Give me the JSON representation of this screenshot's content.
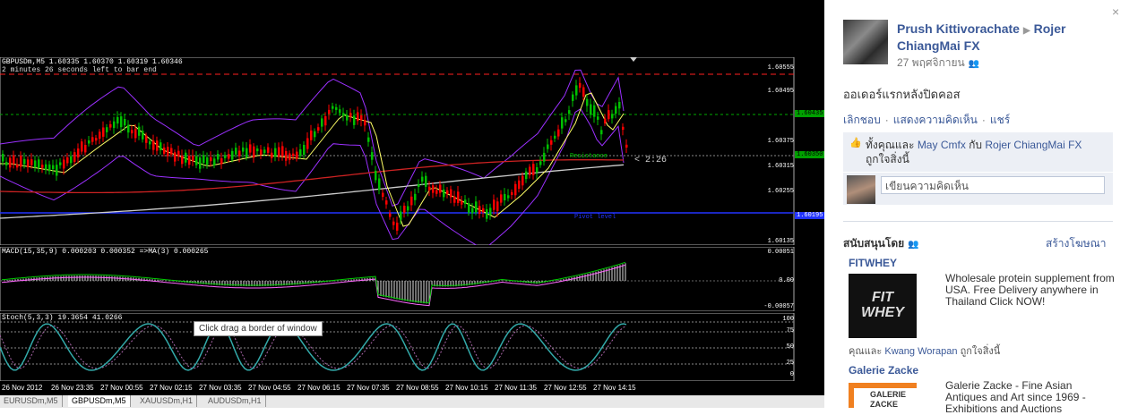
{
  "chart": {
    "price_title": "GBPUSDm,M5  1.60335 1.60370 1.60319 1.60346",
    "price_subtitle": "2 minutes 26 seconds left to bar end",
    "price_levels": [
      "1.60555",
      "1.60495",
      "1.60375",
      "1.60315",
      "1.60255",
      "1.60135"
    ],
    "price_badges": [
      "1.60435",
      "1.60350",
      "1.60195"
    ],
    "countdown": "< 2:26",
    "label_resistance": "Resistance",
    "label_pivot": "Pivot level",
    "macd_title": "MACD(15,35,9) 0.000203 0.000352  =>MA(3) 0.000265",
    "macd_levels": [
      "0.00051",
      "0.00",
      "-0.00057"
    ],
    "stoch_title": "Stoch(5,3,3) 19.3654 41.0266",
    "stoch_levels": [
      "100",
      "75",
      "50",
      "25",
      "0"
    ],
    "tooltip": "Click  drag a border of window",
    "time_labels": [
      "26 Nov 2012",
      "26 Nov 23:35",
      "27 Nov 00:55",
      "27 Nov 02:15",
      "27 Nov 03:35",
      "27 Nov 04:55",
      "27 Nov 06:15",
      "27 Nov 07:35",
      "27 Nov 08:55",
      "27 Nov 10:15",
      "27 Nov 11:35",
      "27 Nov 12:55",
      "27 Nov 14:15"
    ],
    "tabs": [
      "EURUSDm,M5",
      "GBPUSDm,M5",
      "XAUUSDm,H1",
      "AUDUSDm,H1"
    ],
    "active_tab": 1,
    "colors": {
      "bull": "#00c000",
      "bear": "#ff0000",
      "band": "#9b30ff",
      "ma_fast": "#ffff66",
      "ma_slow": "#cc2222",
      "ma_long": "#cccccc",
      "pivot": "#2233ff",
      "stoch": "#33aaaa"
    }
  },
  "post": {
    "close": "×",
    "author": "Prush Kittivorachate",
    "target": "Rojer ChiangMai FX",
    "date": "27 พฤศจิกายน",
    "text": "ออเดอร์แรกหลังปิดคอส",
    "actions": [
      "เลิกชอบ",
      "แสดงความคิดเห็น",
      "แชร์"
    ],
    "likes_prefix": "ทั้งคุณและ",
    "likes_name1": "May Cmfx",
    "likes_and": "กับ",
    "likes_name2": "Rojer ChiangMai FX",
    "likes_suffix": "ถูกใจสิ่งนี้",
    "comment_placeholder": "เขียนความคิดเห็น"
  },
  "sponsored": {
    "heading": "สนับสนุนโดย",
    "create_ad": "สร้างโฆษณา",
    "ads": [
      {
        "title": "FITWHEY",
        "body": "Wholesale protein supplement from USA. Free Delivery anywhere in Thailand Click NOW!",
        "img_text": "FIT WHEY",
        "like_prefix": "คุณและ",
        "like_name": "Kwang Worapan",
        "like_suffix": "ถูกใจสิ่งนี้"
      },
      {
        "title": "Galerie Zacke",
        "body": "Galerie Zacke - Fine Asian Antiques and Art since 1969 - Exhibitions and Auctions",
        "img_text": "GALERIE ZACKE"
      }
    ]
  }
}
